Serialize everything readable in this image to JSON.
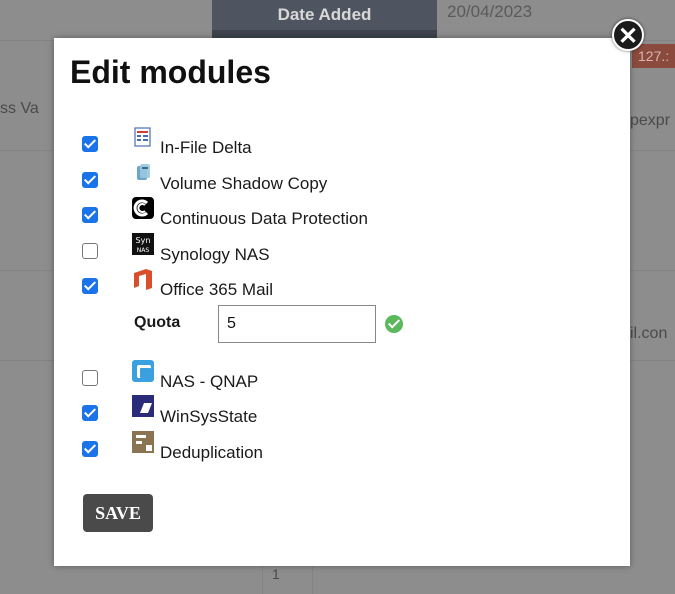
{
  "background": {
    "header_cell": "Date Added",
    "date_value": "20/04/2023",
    "badge": "127.:",
    "left_text": "ss Va",
    "right_text": "pexpr",
    "email_fragment": "il.con",
    "page_num": "1"
  },
  "modal": {
    "title": "Edit modules",
    "close_symbol": "✕",
    "modules": [
      {
        "label": "In-File Delta",
        "checked": true,
        "icon": "in-file-delta-icon"
      },
      {
        "label": "Volume Shadow Copy",
        "checked": true,
        "icon": "volume-shadow-copy-icon"
      },
      {
        "label": "Continuous Data Protection",
        "checked": true,
        "icon": "cdp-icon"
      },
      {
        "label": "Synology NAS",
        "checked": false,
        "icon": "synology-icon"
      },
      {
        "label": "Office 365 Mail",
        "checked": true,
        "icon": "office365-icon"
      },
      {
        "label": "NAS - QNAP",
        "checked": false,
        "icon": "qnap-icon"
      },
      {
        "label": "WinSysState",
        "checked": true,
        "icon": "winsysstate-icon"
      },
      {
        "label": "Deduplication",
        "checked": true,
        "icon": "deduplication-icon"
      }
    ],
    "quota": {
      "label": "Quota",
      "value": "5"
    },
    "save_label": "SAVE"
  }
}
